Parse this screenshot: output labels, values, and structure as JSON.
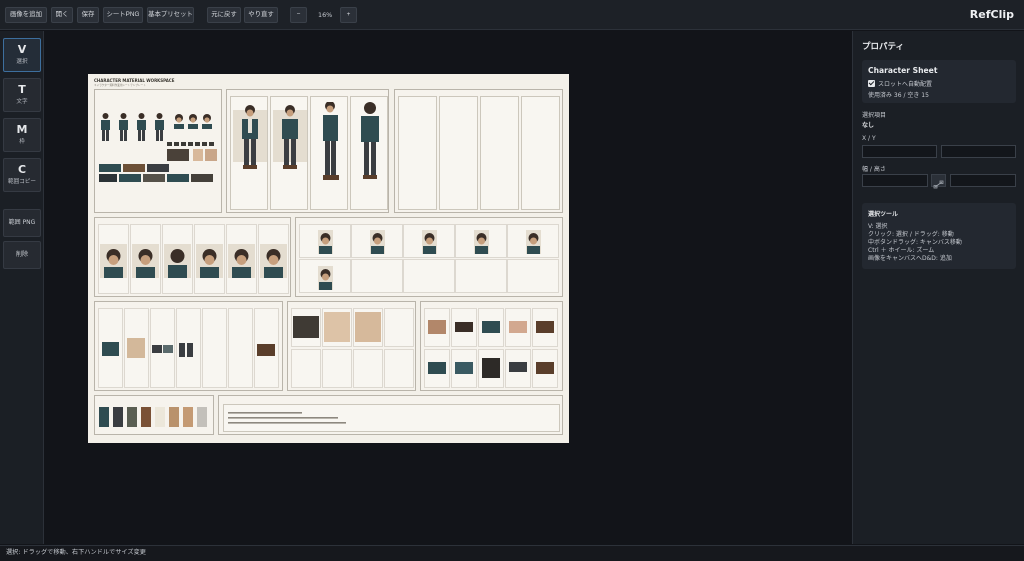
{
  "toolbar": {
    "add_image": "画像を追加",
    "open": "開く",
    "save": "保存",
    "sheet_png": "シートPNG",
    "basic_preset": "基本プリセット",
    "undo": "元に戻す",
    "redo": "やり直す",
    "zoom_out": "−",
    "zoom_level": "16%",
    "zoom_in": "+"
  },
  "app_title": "RefClip",
  "tools": [
    {
      "key": "V",
      "label": "選択"
    },
    {
      "key": "T",
      "label": "文字"
    },
    {
      "key": "M",
      "label": "枠"
    },
    {
      "key": "C",
      "label": "範囲コピー"
    }
  ],
  "range_png": "範囲 PNG",
  "delete": "削除",
  "sheet": {
    "title": "CHARACTER MATERIAL WORKSPACE",
    "subtitle": "キャラクター資料作業用シートテンプレート",
    "swatch_colors": [
      "#2f4c51",
      "#3a3d41",
      "#5a5e52",
      "#7a5136",
      "#ece7da",
      "#b9926c",
      "#c49a73",
      "#c3c0ba"
    ]
  },
  "properties": {
    "title": "プロパティ",
    "sheet_name": "Character Sheet",
    "auto_place_label": "スロットへ自動配置",
    "usage": "使用済み 36 / 空き 15",
    "selection_label": "選択項目",
    "selection_value": "なし",
    "xy_label": "X / Y",
    "wh_label": "幅 / 高さ"
  },
  "tool_help": {
    "title": "選択ツール",
    "lines": [
      "V: 選択",
      "クリック: 選択 / ドラッグ: 移動",
      "中ボタンドラッグ: キャンバス移動",
      "Ctrl ＋ ホイール: ズーム",
      "画像をキャンバスへD&D: 追加"
    ]
  },
  "status_text": "選択: ドラッグで移動、右下ハンドルでサイズ変更"
}
